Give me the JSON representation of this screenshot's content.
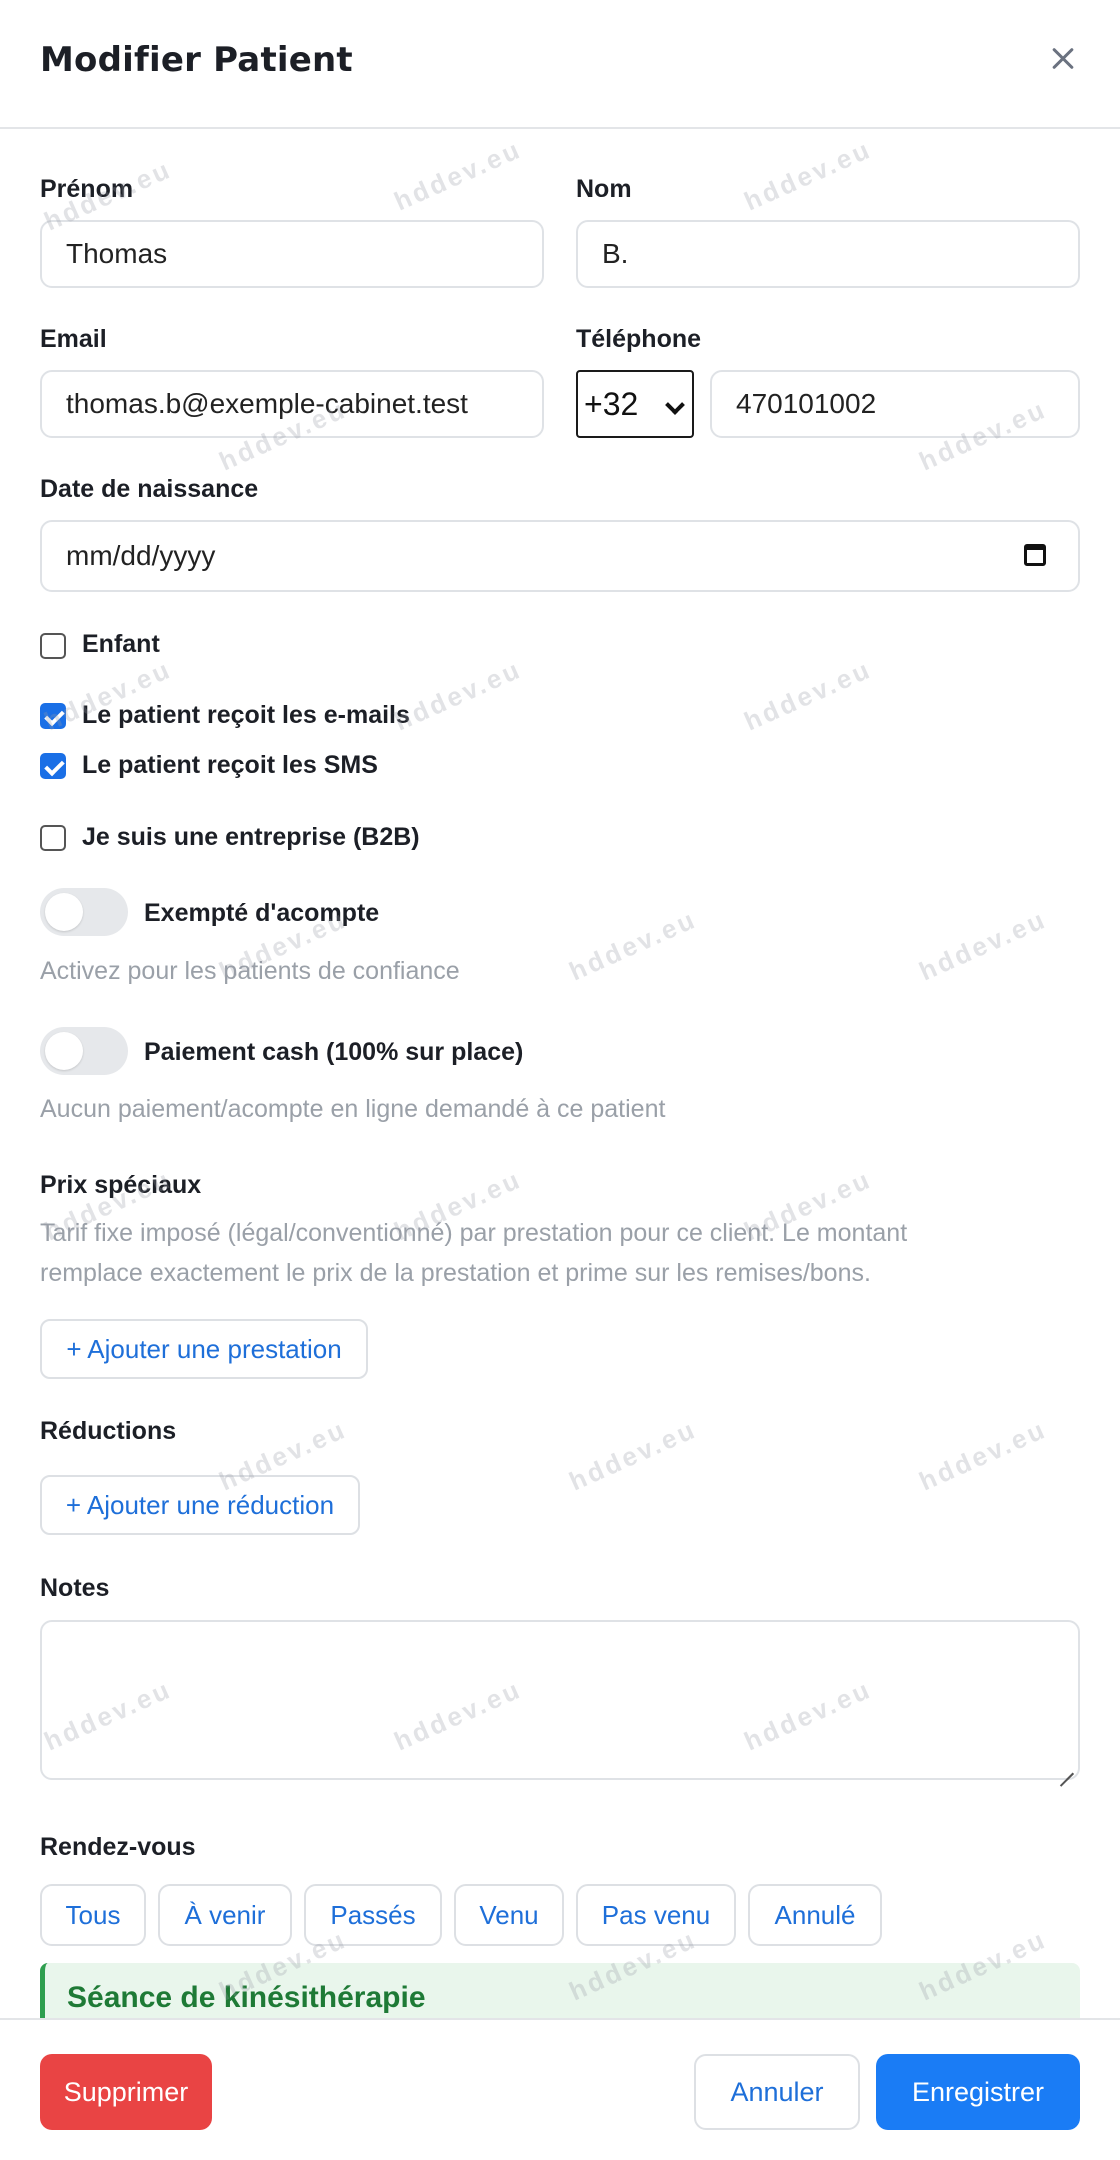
{
  "header": {
    "title": "Modifier Patient",
    "close_icon": "close-icon"
  },
  "form": {
    "first_name": {
      "label": "Prénom",
      "value": "Thomas"
    },
    "last_name": {
      "label": "Nom",
      "value": "B."
    },
    "email": {
      "label": "Email",
      "value": "thomas.b@exemple-cabinet.test"
    },
    "phone": {
      "label": "Téléphone",
      "country_code": "+32",
      "number": "470101002"
    },
    "birth_date": {
      "label": "Date de naissance",
      "placeholder": "mm/dd/yyyy"
    },
    "checkboxes": {
      "child": {
        "label": "Enfant",
        "checked": false
      },
      "emails": {
        "label": "Le patient reçoit les e-mails",
        "checked": true
      },
      "sms": {
        "label": "Le patient reçoit les SMS",
        "checked": true
      },
      "b2b": {
        "label": "Je suis une entreprise (B2B)",
        "checked": false
      }
    },
    "toggles": {
      "deposit_exempt": {
        "label": "Exempté d'acompte",
        "help": "Activez pour les patients de confiance",
        "on": false
      },
      "cash_payment": {
        "label": "Paiement cash (100% sur place)",
        "help": "Aucun paiement/acompte en ligne demandé à ce patient",
        "on": false
      }
    },
    "special_prices": {
      "label": "Prix spéciaux",
      "help_line1": "Tarif fixe imposé (légal/conventionné) par prestation pour ce client. Le montant",
      "help_line2": "remplace exactement le prix de la prestation et prime sur les remises/bons.",
      "add_button": "+ Ajouter une prestation"
    },
    "discounts": {
      "label": "Réductions",
      "add_button": "+ Ajouter une réduction"
    },
    "notes": {
      "label": "Notes",
      "value": ""
    }
  },
  "appointments": {
    "label": "Rendez-vous",
    "filters": [
      "Tous",
      "À venir",
      "Passés",
      "Venu",
      "Pas venu",
      "Annulé"
    ],
    "first_item_title": "Séance de kinésithérapie"
  },
  "footer": {
    "delete": "Supprimer",
    "cancel": "Annuler",
    "save": "Enregistrer"
  },
  "watermark": "hddev.eu",
  "colors": {
    "primary": "#1a7cf5",
    "danger": "#e94444",
    "link": "#1e6fd9",
    "success": "#2e9e4f"
  }
}
